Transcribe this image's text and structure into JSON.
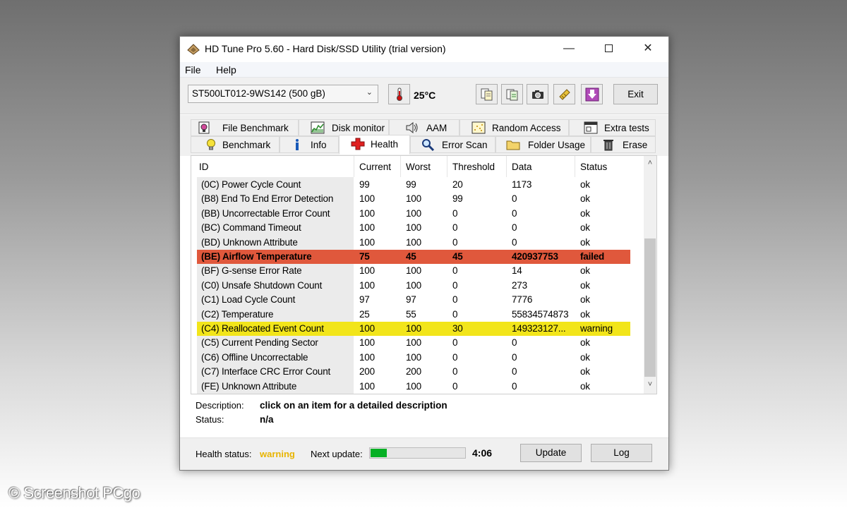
{
  "window": {
    "title": "HD Tune Pro 5.60 - Hard Disk/SSD Utility (trial version)",
    "controls": {
      "minimize": "—",
      "close": "✕"
    }
  },
  "menu": {
    "file": "File",
    "help": "Help"
  },
  "toolbar": {
    "drive": "ST500LT012-9WS142 (500 gB)",
    "temperature": "25°C",
    "exit_label": "Exit"
  },
  "tabs": {
    "row1": [
      {
        "label": "File Benchmark",
        "icon": "file-benchmark-icon"
      },
      {
        "label": "Disk monitor",
        "icon": "disk-monitor-icon"
      },
      {
        "label": "AAM",
        "icon": "speaker-icon"
      },
      {
        "label": "Random Access",
        "icon": "random-access-icon"
      },
      {
        "label": "Extra tests",
        "icon": "extra-tests-icon"
      }
    ],
    "row2": [
      {
        "label": "Benchmark",
        "icon": "lightbulb-icon"
      },
      {
        "label": "Info",
        "icon": "info-icon"
      },
      {
        "label": "Health",
        "icon": "health-cross-icon",
        "active": true
      },
      {
        "label": "Error Scan",
        "icon": "magnifier-icon"
      },
      {
        "label": "Folder Usage",
        "icon": "folder-icon"
      },
      {
        "label": "Erase",
        "icon": "trash-icon"
      }
    ]
  },
  "grid": {
    "columns": [
      "ID",
      "Current",
      "Worst",
      "Threshold",
      "Data",
      "Status"
    ],
    "rows": [
      {
        "id": "(0C) Power Cycle Count",
        "current": "99",
        "worst": "99",
        "threshold": "20",
        "data": "1173",
        "status": "ok"
      },
      {
        "id": "(B8) End To End Error Detection",
        "current": "100",
        "worst": "100",
        "threshold": "99",
        "data": "0",
        "status": "ok"
      },
      {
        "id": "(BB) Uncorrectable Error Count",
        "current": "100",
        "worst": "100",
        "threshold": "0",
        "data": "0",
        "status": "ok"
      },
      {
        "id": "(BC) Command Timeout",
        "current": "100",
        "worst": "100",
        "threshold": "0",
        "data": "0",
        "status": "ok"
      },
      {
        "id": "(BD) Unknown Attribute",
        "current": "100",
        "worst": "100",
        "threshold": "0",
        "data": "0",
        "status": "ok"
      },
      {
        "id": "(BE) Airflow Temperature",
        "current": "75",
        "worst": "45",
        "threshold": "45",
        "data": "420937753",
        "status": "failed"
      },
      {
        "id": "(BF) G-sense Error Rate",
        "current": "100",
        "worst": "100",
        "threshold": "0",
        "data": "14",
        "status": "ok"
      },
      {
        "id": "(C0) Unsafe Shutdown Count",
        "current": "100",
        "worst": "100",
        "threshold": "0",
        "data": "273",
        "status": "ok"
      },
      {
        "id": "(C1) Load Cycle Count",
        "current": "97",
        "worst": "97",
        "threshold": "0",
        "data": "7776",
        "status": "ok"
      },
      {
        "id": "(C2) Temperature",
        "current": "25",
        "worst": "55",
        "threshold": "0",
        "data": "55834574873",
        "status": "ok"
      },
      {
        "id": "(C4) Reallocated Event Count",
        "current": "100",
        "worst": "100",
        "threshold": "30",
        "data": "149323127...",
        "status": "warning"
      },
      {
        "id": "(C5) Current Pending Sector",
        "current": "100",
        "worst": "100",
        "threshold": "0",
        "data": "0",
        "status": "ok"
      },
      {
        "id": "(C6) Offline Uncorrectable",
        "current": "100",
        "worst": "100",
        "threshold": "0",
        "data": "0",
        "status": "ok"
      },
      {
        "id": "(C7) Interface CRC Error Count",
        "current": "200",
        "worst": "200",
        "threshold": "0",
        "data": "0",
        "status": "ok"
      },
      {
        "id": "(FE) Unknown Attribute",
        "current": "100",
        "worst": "100",
        "threshold": "0",
        "data": "0",
        "status": "ok"
      }
    ],
    "colors": {
      "failed": "#e0583c",
      "warning": "#f2e51a"
    }
  },
  "description": {
    "label": "Description:",
    "value": "click on an item for a detailed description",
    "status_label": "Status:",
    "status_value": "n/a"
  },
  "statusbar": {
    "health_label": "Health status:",
    "health_value": "warning",
    "next_update_label": "Next update:",
    "progress": 0.17,
    "countdown": "4:06",
    "update_label": "Update",
    "log_label": "Log"
  },
  "watermark": "© Screenshot PCgo"
}
